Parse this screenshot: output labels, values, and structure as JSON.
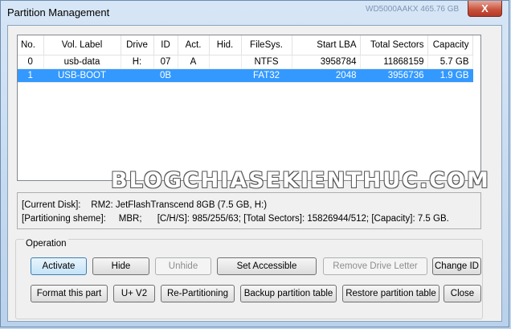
{
  "window": {
    "title": "Partition Management",
    "close_glyph": "X",
    "background_text": "WD5000AAKX  465.76 GB"
  },
  "table": {
    "columns": [
      "No.",
      "Vol. Label",
      "Drive",
      "ID",
      "Act.",
      "Hid.",
      "FileSys.",
      "Start LBA",
      "Total Sectors",
      "Capacity"
    ],
    "rows": [
      [
        "0",
        "usb-data",
        "H:",
        "07",
        "A",
        "",
        "NTFS",
        "3958784",
        "11868159",
        "5.7 GB"
      ],
      [
        "1",
        "USB-BOOT",
        "",
        "0B",
        "",
        "",
        "FAT32",
        "2048",
        "3956736",
        "1.9 GB"
      ]
    ],
    "selected_row": 1
  },
  "disk_info": {
    "line1": "[Current Disk]:    RM2: JetFlashTranscend 8GB (7.5 GB, H:)",
    "line2": "[Partitioning sheme]:     MBR;      [C/H/S]: 985/255/63; [Total Sectors]: 15826944/512; [Capacity]: 7.5 GB."
  },
  "watermark": "BLOGCHIASEKIENTHUC.COM",
  "operation": {
    "label": "Operation",
    "buttons": {
      "activate": "Activate",
      "hide": "Hide",
      "unhide": "Unhide",
      "set_accessible": "Set Accessible",
      "remove_drive_letter": "Remove Drive Letter",
      "change_id": "Change ID",
      "format": "Format this part",
      "uv2": "U+ V2",
      "repartitioning": "Re-Partitioning",
      "backup": "Backup partition table",
      "restore": "Restore partition table",
      "close": "Close"
    }
  }
}
